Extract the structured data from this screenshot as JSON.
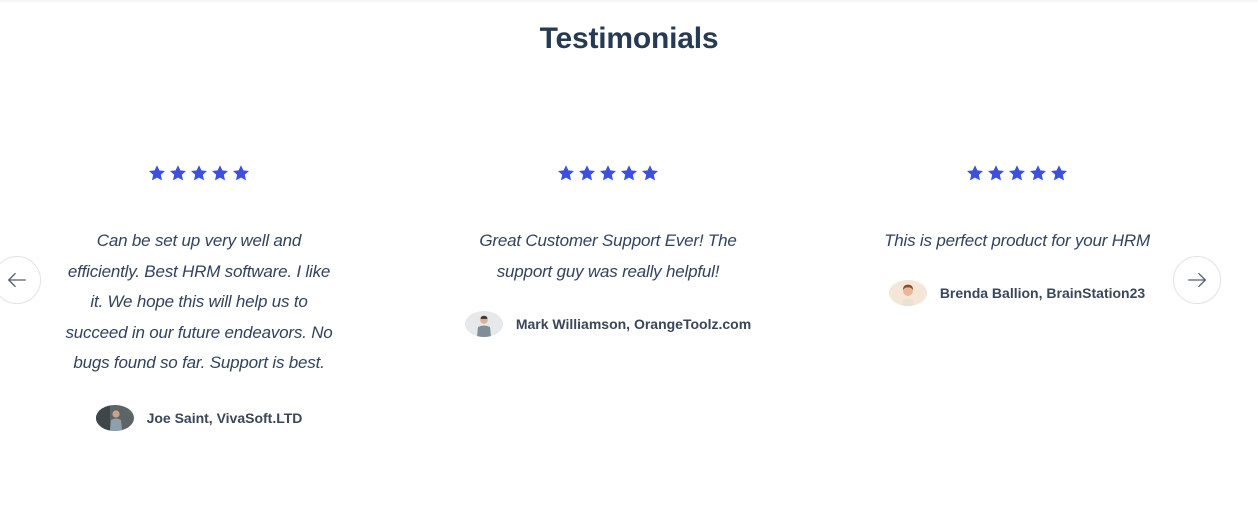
{
  "section": {
    "title": "Testimonials"
  },
  "colors": {
    "star": "#3d4fe0",
    "title": "#273a54",
    "quote_text": "#33435c",
    "author_text": "#3b4659"
  },
  "navigation": {
    "prev_icon": "arrow-left-icon",
    "next_icon": "arrow-right-icon"
  },
  "testimonials": [
    {
      "rating": 5,
      "quote_lines": [
        "Can be set up very well and",
        "efficiently. Best HRM software. I like",
        "it. We hope this will help us to",
        "succeed in our future endeavors. No",
        "bugs found so far. Support is best."
      ],
      "author": "Joe Saint, VivaSoft.LTD"
    },
    {
      "rating": 5,
      "quote_lines": [
        "Great Customer Support Ever! The",
        "support guy was really helpful!"
      ],
      "author": "Mark Williamson, OrangeToolz.com"
    },
    {
      "rating": 5,
      "quote_lines": [
        "This is perfect product for your HRM"
      ],
      "author": "Brenda Ballion, BrainStation23"
    }
  ]
}
